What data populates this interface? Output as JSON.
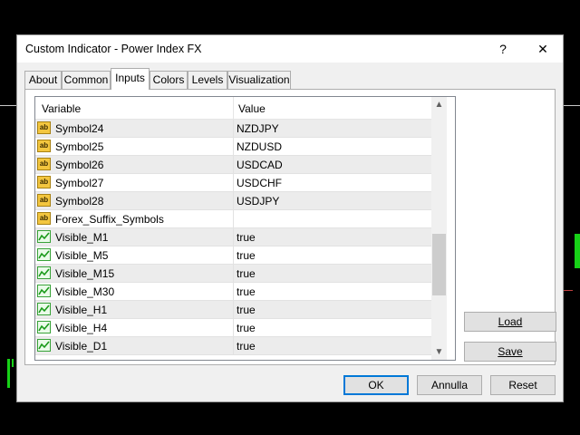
{
  "window": {
    "title": "Custom Indicator - Power Index FX",
    "help_label": "?",
    "close_label": "✕"
  },
  "tabs": [
    {
      "label": "About"
    },
    {
      "label": "Common"
    },
    {
      "label": "Inputs",
      "active": true
    },
    {
      "label": "Colors"
    },
    {
      "label": "Levels"
    },
    {
      "label": "Visualization"
    }
  ],
  "grid": {
    "columns": [
      "Variable",
      "Value"
    ],
    "rows": [
      {
        "icon": "string-param-icon",
        "variable": "Symbol24",
        "value": "NZDJPY"
      },
      {
        "icon": "string-param-icon",
        "variable": "Symbol25",
        "value": "NZDUSD"
      },
      {
        "icon": "string-param-icon",
        "variable": "Symbol26",
        "value": "USDCAD"
      },
      {
        "icon": "string-param-icon",
        "variable": "Symbol27",
        "value": "USDCHF"
      },
      {
        "icon": "string-param-icon",
        "variable": "Symbol28",
        "value": "USDJPY"
      },
      {
        "icon": "string-param-icon",
        "variable": "Forex_Suffix_Symbols",
        "value": ""
      },
      {
        "icon": "bool-param-icon",
        "variable": "Visible_M1",
        "value": "true"
      },
      {
        "icon": "bool-param-icon",
        "variable": "Visible_M5",
        "value": "true"
      },
      {
        "icon": "bool-param-icon",
        "variable": "Visible_M15",
        "value": "true"
      },
      {
        "icon": "bool-param-icon",
        "variable": "Visible_M30",
        "value": "true"
      },
      {
        "icon": "bool-param-icon",
        "variable": "Visible_H1",
        "value": "true"
      },
      {
        "icon": "bool-param-icon",
        "variable": "Visible_H4",
        "value": "true"
      },
      {
        "icon": "bool-param-icon",
        "variable": "Visible_D1",
        "value": "true"
      }
    ]
  },
  "side_buttons": {
    "load_label": "Load",
    "save_label": "Save"
  },
  "footer_buttons": {
    "ok_label": "OK",
    "cancel_label": "Annulla",
    "reset_label": "Reset"
  },
  "icon_text": {
    "string": "ab"
  }
}
